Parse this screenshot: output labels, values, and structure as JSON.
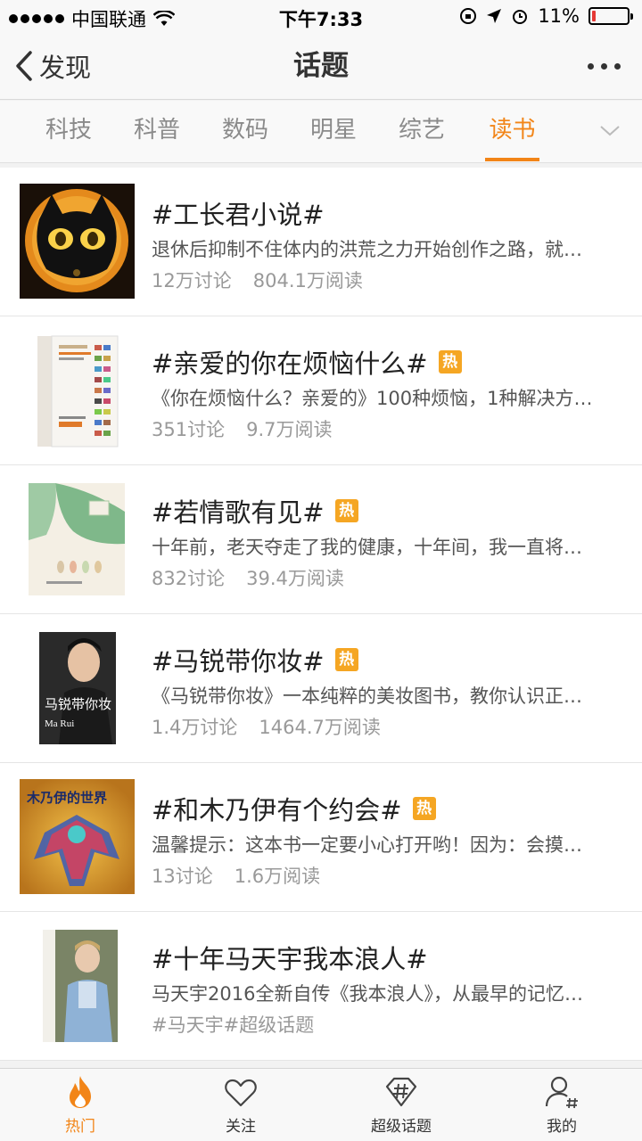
{
  "status_bar": {
    "carrier": "中国联通",
    "time": "下午7:33",
    "battery": "11%",
    "battery_level": 0.11
  },
  "nav": {
    "back_label": "发现",
    "title": "话题"
  },
  "tabs": [
    {
      "label": "科技"
    },
    {
      "label": "科普"
    },
    {
      "label": "数码"
    },
    {
      "label": "明星"
    },
    {
      "label": "综艺"
    },
    {
      "label": "读书",
      "active": true
    }
  ],
  "topics": [
    {
      "title": "#工长君小说#",
      "hot": false,
      "desc": "退休后抑制不住体内的洪荒之力开始创作之路，就…",
      "discussions": "12万讨论",
      "reads": "804.1万阅读"
    },
    {
      "title": "#亲爱的你在烦恼什么#",
      "hot": true,
      "desc": "《你在烦恼什么？亲爱的》100种烦恼，1种解决方…",
      "discussions": "351讨论",
      "reads": "9.7万阅读"
    },
    {
      "title": "#若情歌有见#",
      "hot": true,
      "desc": "十年前，老天夺走了我的健康，十年间，我一直将…",
      "discussions": "832讨论",
      "reads": "39.4万阅读"
    },
    {
      "title": "#马锐带你妆#",
      "hot": true,
      "desc": "《马锐带你妆》一本纯粹的美妆图书，教你认识正…",
      "discussions": "1.4万讨论",
      "reads": "1464.7万阅读"
    },
    {
      "title": "#和木乃伊有个约会#",
      "hot": true,
      "desc": "温馨提示：这本书一定要小心打开哟！因为：会摸…",
      "discussions": "13讨论",
      "reads": "1.6万阅读"
    },
    {
      "title": "#十年马天宇我本浪人#",
      "hot": false,
      "desc": "马天宇2016全新自传《我本浪人》，从最早的记忆…",
      "discussions": "#马天宇#超级话题",
      "reads": ""
    }
  ],
  "hot_label": "热",
  "thumb_text": {
    "book4_title": "马锐带你妆",
    "book4_sub": "Ma Rui",
    "book5_title": "木乃伊的世界"
  },
  "tabbar": [
    {
      "label": "热门",
      "icon": "flame-icon",
      "active": true
    },
    {
      "label": "关注",
      "icon": "heart-icon"
    },
    {
      "label": "超级话题",
      "icon": "super-topic-icon"
    },
    {
      "label": "我的",
      "icon": "profile-icon"
    }
  ],
  "colors": {
    "accent": "#f28518",
    "hot_badge": "#f5a623"
  }
}
